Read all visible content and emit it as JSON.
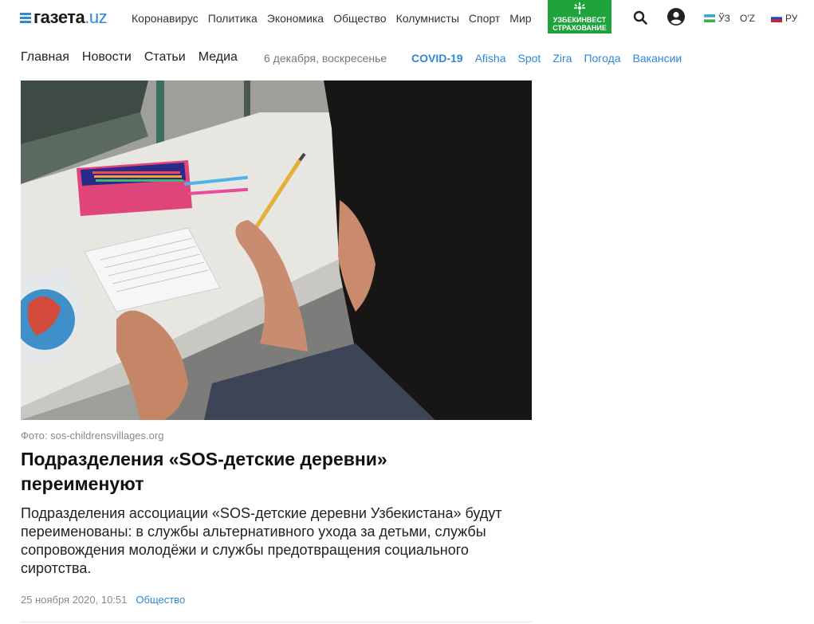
{
  "header": {
    "logo_text": "газета",
    "logo_tld": ".uz",
    "nav": [
      "Коронавирус",
      "Политика",
      "Экономика",
      "Общество",
      "Колумнисты",
      "Спорт",
      "Мир"
    ],
    "ad": {
      "line1": "УЗБЕКИНВЕСТ",
      "line2": "СТРАХОВАНИЕ",
      "color": "#1fa33b"
    },
    "langs": [
      {
        "label": "ЎЗ",
        "flag": "uz-flag-icon"
      },
      {
        "label": "O'Z"
      },
      {
        "label": "РУ",
        "flag": "ru-flag-icon"
      }
    ]
  },
  "subnav": {
    "main": [
      "Главная",
      "Новости",
      "Статьи",
      "Медиа"
    ],
    "date": "6 декабря, воскресенье",
    "quick": [
      "COVID-19",
      "Afisha",
      "Spot",
      "Zira",
      "Погода",
      "Вакансии"
    ]
  },
  "article": {
    "photo_credit": "Фото: sos-childrensvillages.org",
    "title": "Подразделения «SOS-детские деревни» переименуют",
    "lead": "Подразделения ассоциации «SOS-детские деревни Узбекистана» будут переименованы: в службы альтернативного ухода за детьми, службы сопровождения молодёжи и службы предотвращения социального сиротства.",
    "date": "25 ноября 2020, 10:51",
    "category": "Общество"
  },
  "colors": {
    "accent": "#2f87d6",
    "brand_green": "#1fa33b"
  }
}
